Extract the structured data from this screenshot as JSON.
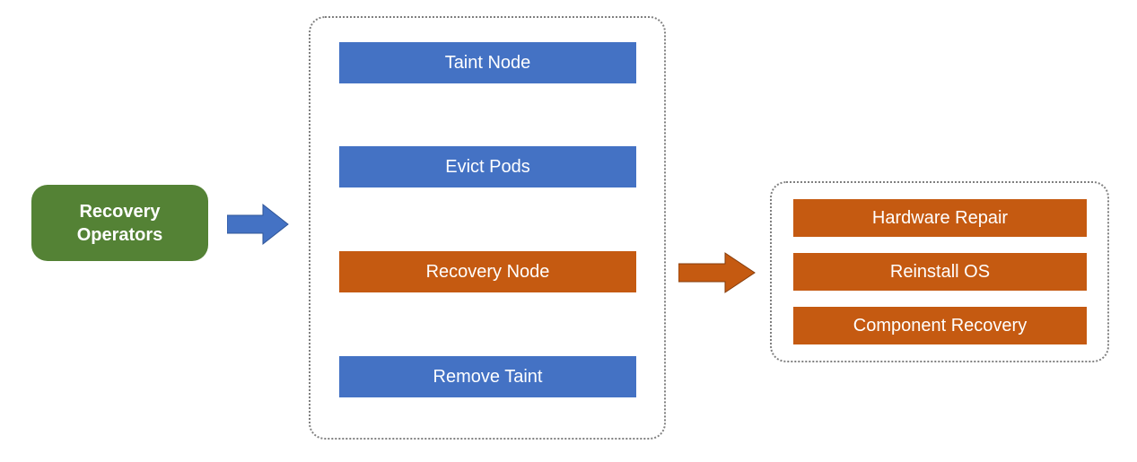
{
  "left_box": {
    "label": "Recovery\nOperators"
  },
  "main_steps": [
    {
      "label": "Taint Node",
      "color": "blue"
    },
    {
      "label": "Evict Pods",
      "color": "blue"
    },
    {
      "label": "Recovery Node",
      "color": "orange"
    },
    {
      "label": "Remove Taint",
      "color": "blue"
    }
  ],
  "detail_steps": [
    {
      "label": "Hardware Repair"
    },
    {
      "label": "Reinstall OS"
    },
    {
      "label": "Component Recovery"
    }
  ]
}
